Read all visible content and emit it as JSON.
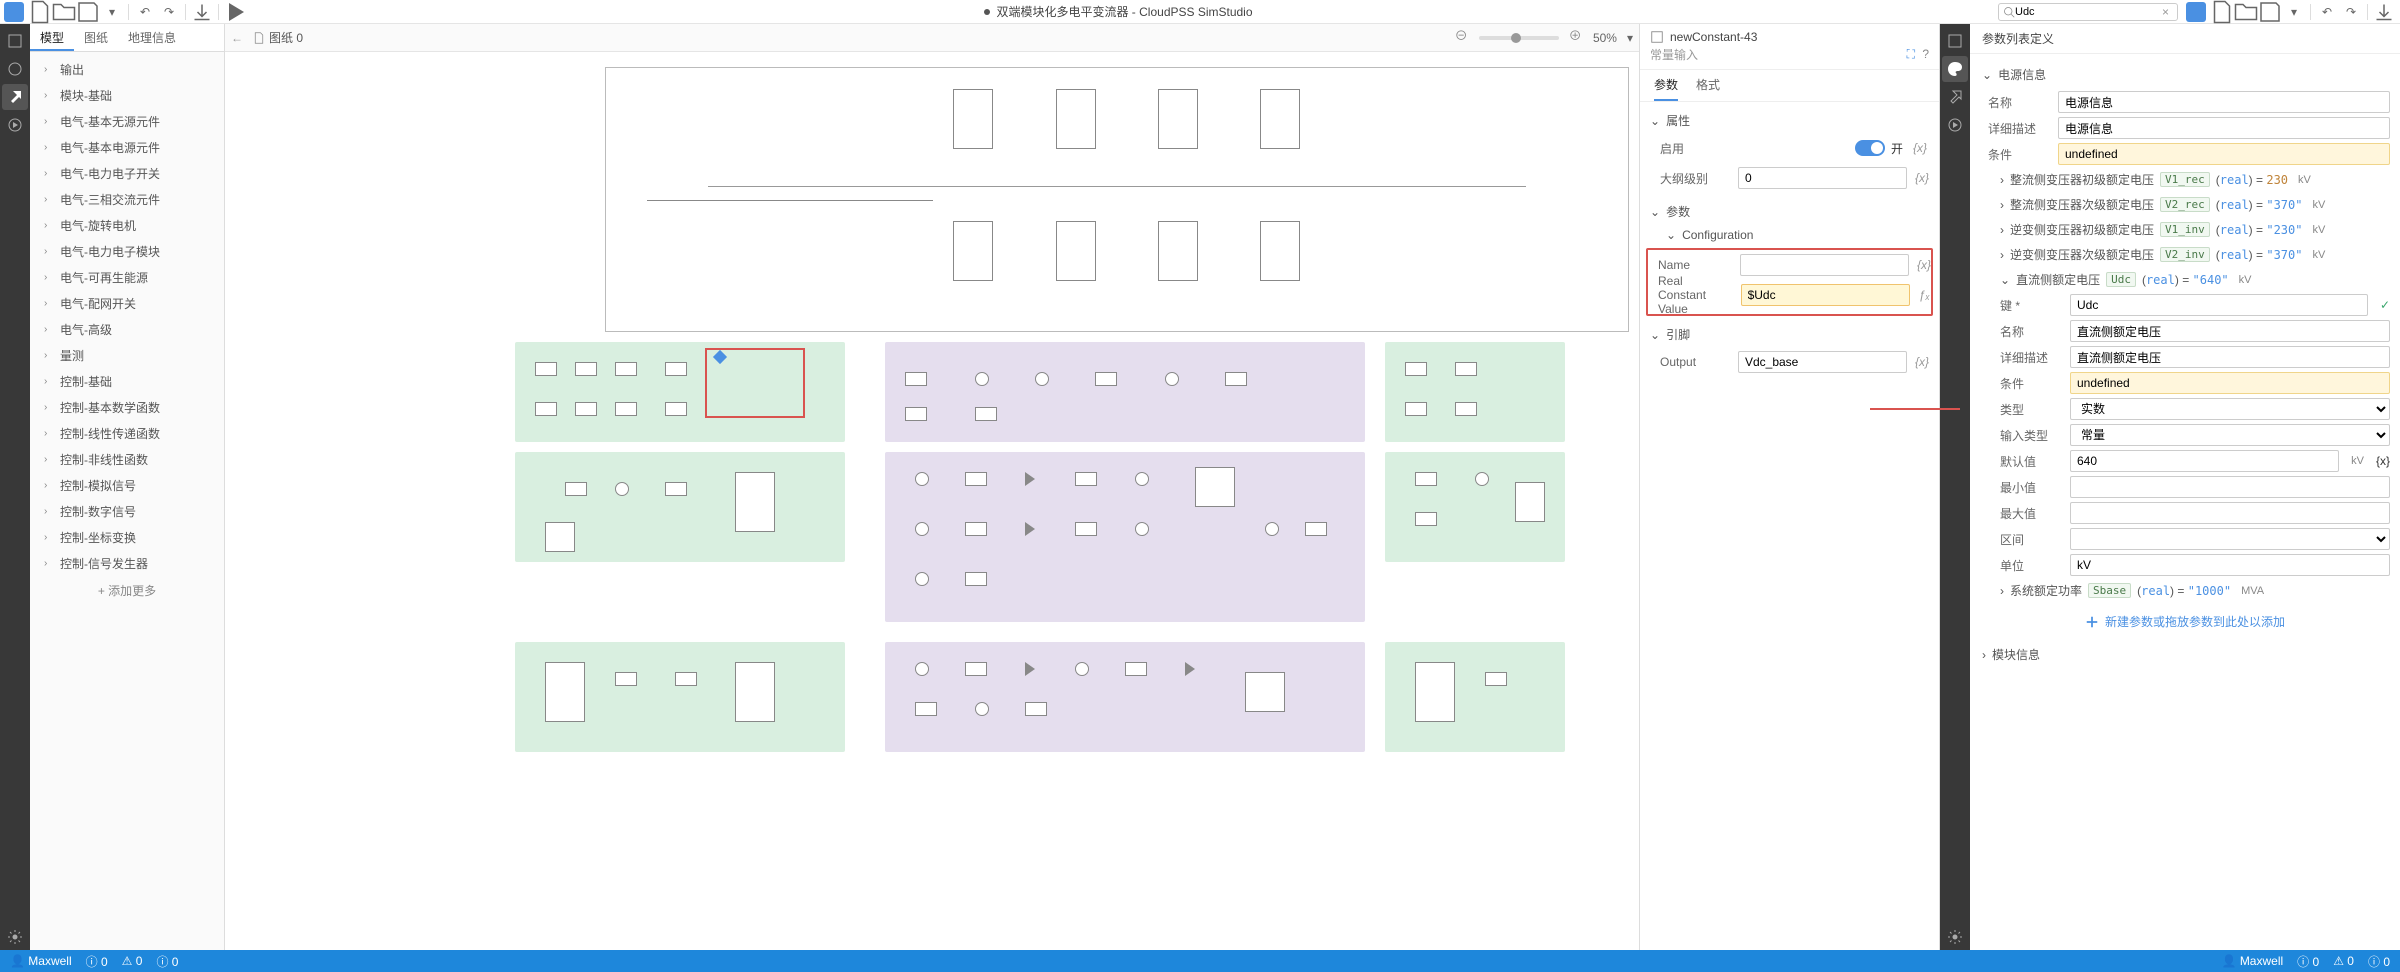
{
  "app": {
    "title": "双端模块化多电平变流器 - CloudPSS SimStudio",
    "search_value": "Udc"
  },
  "leftTabs": {
    "t0": "模型",
    "t1": "图纸",
    "t2": "地理信息"
  },
  "tree": [
    "输出",
    "模块-基础",
    "电气-基本无源元件",
    "电气-基本电源元件",
    "电气-电力电子开关",
    "电气-三相交流元件",
    "电气-旋转电机",
    "电气-电力电子模块",
    "电气-可再生能源",
    "电气-配网开关",
    "电气-高级",
    "量测",
    "控制-基础",
    "控制-基本数学函数",
    "控制-线性传递函数",
    "控制-非线性函数",
    "控制-模拟信号",
    "控制-数字信号",
    "控制-坐标变换",
    "控制-信号发生器"
  ],
  "treeAdd": "+  添加更多",
  "canvas": {
    "tab": "图纸 0",
    "zoom": "50%"
  },
  "prop": {
    "id": "newConstant-43",
    "sub": "常量输入",
    "tabs": {
      "t0": "参数",
      "t1": "格式"
    },
    "g_attr": "属性",
    "r_enable": {
      "lab": "启用",
      "val": "开"
    },
    "r_level": {
      "lab": "大纲级别",
      "val": "0"
    },
    "g_param": "参数",
    "g_config": "Configuration",
    "r_name": {
      "lab": "Name",
      "val": ""
    },
    "r_rcv": {
      "lab": "Real Constant Value",
      "val": "$Udc"
    },
    "g_pins": "引脚",
    "r_output": {
      "lab": "Output",
      "val": "Vdc_base"
    }
  },
  "param": {
    "title": "参数列表定义",
    "g0": "电源信息",
    "name": {
      "lab": "名称",
      "val": "电源信息"
    },
    "desc": {
      "lab": "详细描述",
      "val": "电源信息"
    },
    "cond": {
      "lab": "条件",
      "val": "undefined"
    },
    "exprs": [
      {
        "txt": "整流侧变压器初级额定电压",
        "var": "V1_rec",
        "type": "real",
        "val": "230",
        "unit": "kV",
        "quoted": false
      },
      {
        "txt": "整流侧变压器次级额定电压",
        "var": "V2_rec",
        "type": "real",
        "val": "\"370\"",
        "unit": "kV",
        "quoted": true
      },
      {
        "txt": "逆变侧变压器初级额定电压",
        "var": "V1_inv",
        "type": "real",
        "val": "\"230\"",
        "unit": "kV",
        "quoted": true
      },
      {
        "txt": "逆变侧变压器次级额定电压",
        "var": "V2_inv",
        "type": "real",
        "val": "\"370\"",
        "unit": "kV",
        "quoted": true
      }
    ],
    "active": {
      "txt": "直流侧额定电压",
      "var": "Udc",
      "type": "real",
      "val": "\"640\"",
      "unit": "kV"
    },
    "active_fields": {
      "key": {
        "lab": "键 *",
        "val": "Udc"
      },
      "name": {
        "lab": "名称",
        "val": "直流侧额定电压"
      },
      "desc": {
        "lab": "详细描述",
        "val": "直流侧额定电压"
      },
      "cond": {
        "lab": "条件",
        "val": "undefined"
      },
      "type": {
        "lab": "类型",
        "val": "实数"
      },
      "intype": {
        "lab": "输入类型",
        "val": "常量"
      },
      "default": {
        "lab": "默认值",
        "val": "640",
        "unit": "kV"
      },
      "min": {
        "lab": "最小值",
        "val": ""
      },
      "max": {
        "lab": "最大值",
        "val": ""
      },
      "range": {
        "lab": "区间",
        "val": ""
      },
      "unit": {
        "lab": "单位",
        "val": "kV"
      }
    },
    "expr_last": {
      "txt": "系统额定功率",
      "var": "Sbase",
      "type": "real",
      "val": "\"1000\"",
      "unit": "MVA"
    },
    "add": "新建参数或拖放参数到此处以添加",
    "g1": "模块信息"
  },
  "status": {
    "user": "Maxwell",
    "b0": "0",
    "b1": "0",
    "b2": "0"
  }
}
